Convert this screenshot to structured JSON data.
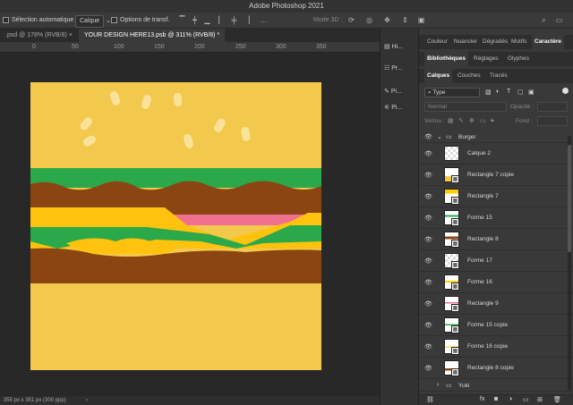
{
  "app_title": "Adobe Photoshop 2021",
  "options_bar": {
    "auto_select_label": "Sélection automatique :",
    "auto_select_value": "Calque",
    "transform_options": "Options de transf.",
    "mode_3d": "Mode 3D :"
  },
  "doc_tabs": [
    {
      "label": ".psd @ 178% (RVB/8) ×"
    },
    {
      "label": "YOUR DESIGN HERE13.psb @ 311% (RVB/8) *"
    }
  ],
  "ruler_ticks": [
    "0",
    "50",
    "100",
    "150",
    "200",
    "250",
    "300",
    "350"
  ],
  "status": "355 px x 351 px (300 ppp)",
  "icon_panel": [
    {
      "label": "Hi...",
      "icon": "history-icon"
    },
    {
      "label": "Pr...",
      "icon": "properties-icon"
    },
    {
      "label": "Pi...",
      "icon": "brush-icon"
    },
    {
      "label": "Pi...",
      "icon": "adjust-icon"
    }
  ],
  "panel_tabs_top": [
    "Couleur",
    "Nuancier",
    "Dégradés",
    "Motifs",
    "Caractère"
  ],
  "panel_tabs_mid": [
    "Bibliothèques",
    "Réglages",
    "Glyphes"
  ],
  "panel_tabs_layers": [
    "Calques",
    "Couches",
    "Tracés"
  ],
  "layers_controls": {
    "filter_type": "Type",
    "blend_mode": "Normal",
    "opacity_label": "Opacité :",
    "lock_label": "Verrou :",
    "fill_label": "Fond :"
  },
  "layers": [
    {
      "name": "Burger",
      "group": true
    },
    {
      "name": "Calque 2",
      "thumb": "#ffffff"
    },
    {
      "name": "Rectangle 7 copie",
      "thumb": "#f1c94a"
    },
    {
      "name": "Rectangle 7",
      "thumb": "#ffcc00"
    },
    {
      "name": "Forme 15",
      "thumb": "#2ea84a"
    },
    {
      "name": "Rectangle 8",
      "thumb": "#8b4513"
    },
    {
      "name": "Forme 17",
      "thumb": "#ffffff"
    },
    {
      "name": "Forme 16",
      "thumb": "#ffcc00"
    },
    {
      "name": "Rectangle 9",
      "thumb": "#f07090"
    },
    {
      "name": "Forme 15 copie",
      "thumb": "#2ea84a"
    },
    {
      "name": "Forme 16 copie",
      "thumb": "#ffcc00"
    },
    {
      "name": "Rectangle 8 copie",
      "thumb": "#8b4513"
    },
    {
      "name": "Yuki",
      "group": true
    }
  ],
  "colors": {
    "bun": "#f2c94c",
    "seed": "#fbe29a",
    "lettuce": "#2ba84a",
    "meat": "#8b4513",
    "ham": "#f07090",
    "cheese": "#ffc20e"
  }
}
